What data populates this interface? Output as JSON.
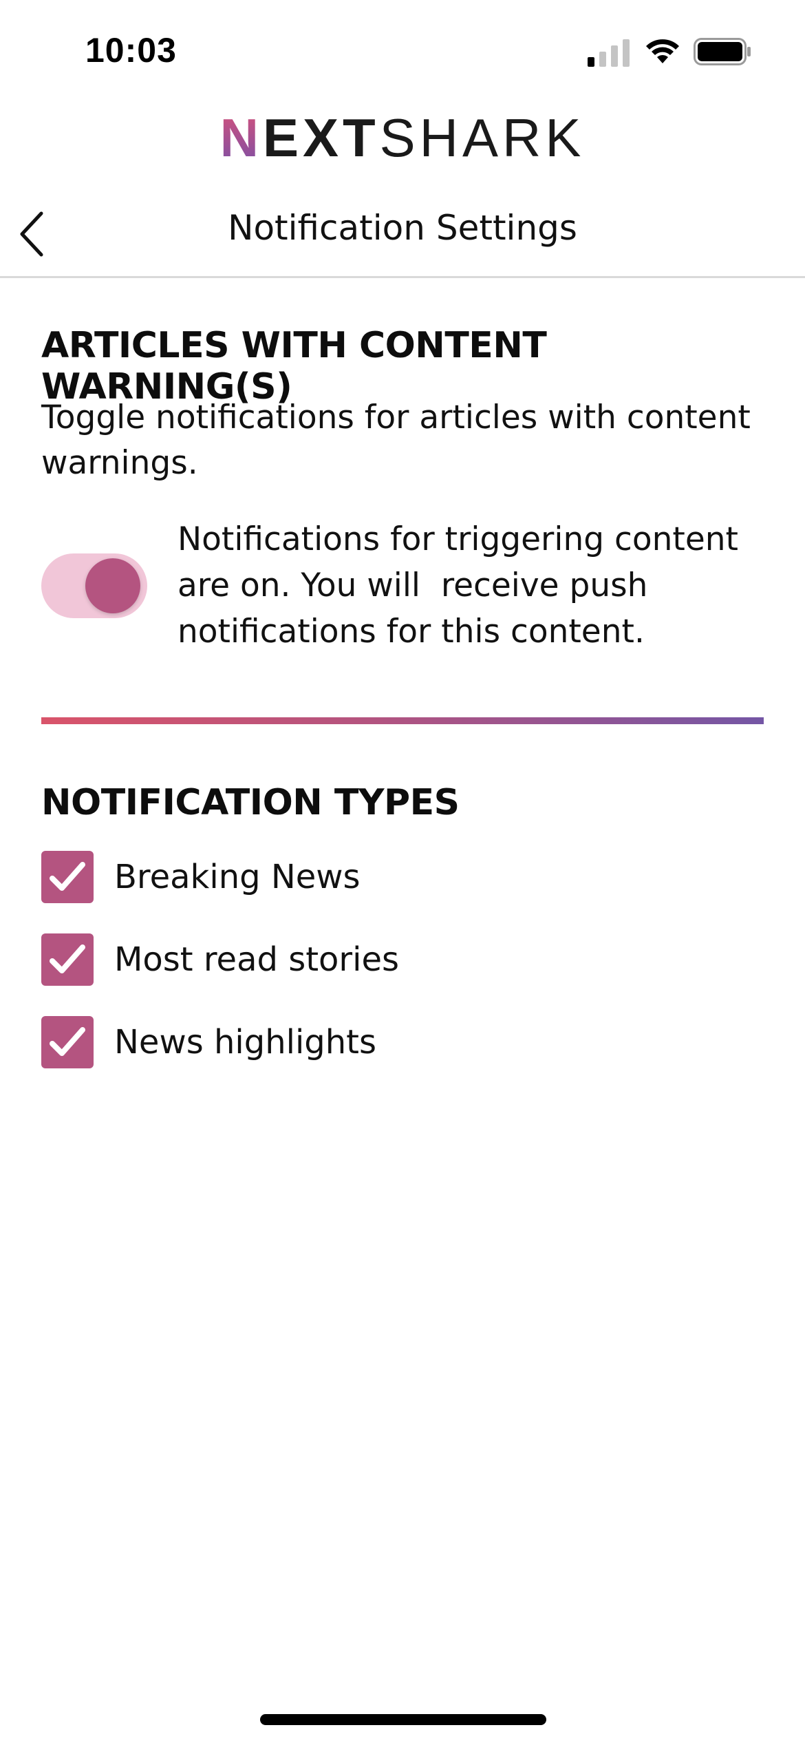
{
  "status_bar": {
    "time": "10:03"
  },
  "logo": {
    "part1": "N",
    "part2": "EXT",
    "part3": "SHARK"
  },
  "nav": {
    "title": "Notification Settings",
    "back_icon": "chevron-left-icon"
  },
  "content_warning": {
    "heading": "ARTICLES WITH CONTENT WARNING(S)",
    "description": "Toggle notifications for articles with content warnings.",
    "toggle_on": true,
    "toggle_text": "Notifications for triggering content are on. You will  receive push notifications for this content."
  },
  "notification_types": {
    "heading": "NOTIFICATION TYPES",
    "items": [
      {
        "label": "Breaking News",
        "checked": true
      },
      {
        "label": "Most read stories",
        "checked": true
      },
      {
        "label": "News highlights",
        "checked": true
      }
    ]
  },
  "colors": {
    "accent": "#b45480",
    "toggle_track": "#f1c6d8",
    "divider_start": "#d9546a",
    "divider_end": "#7456a5"
  }
}
